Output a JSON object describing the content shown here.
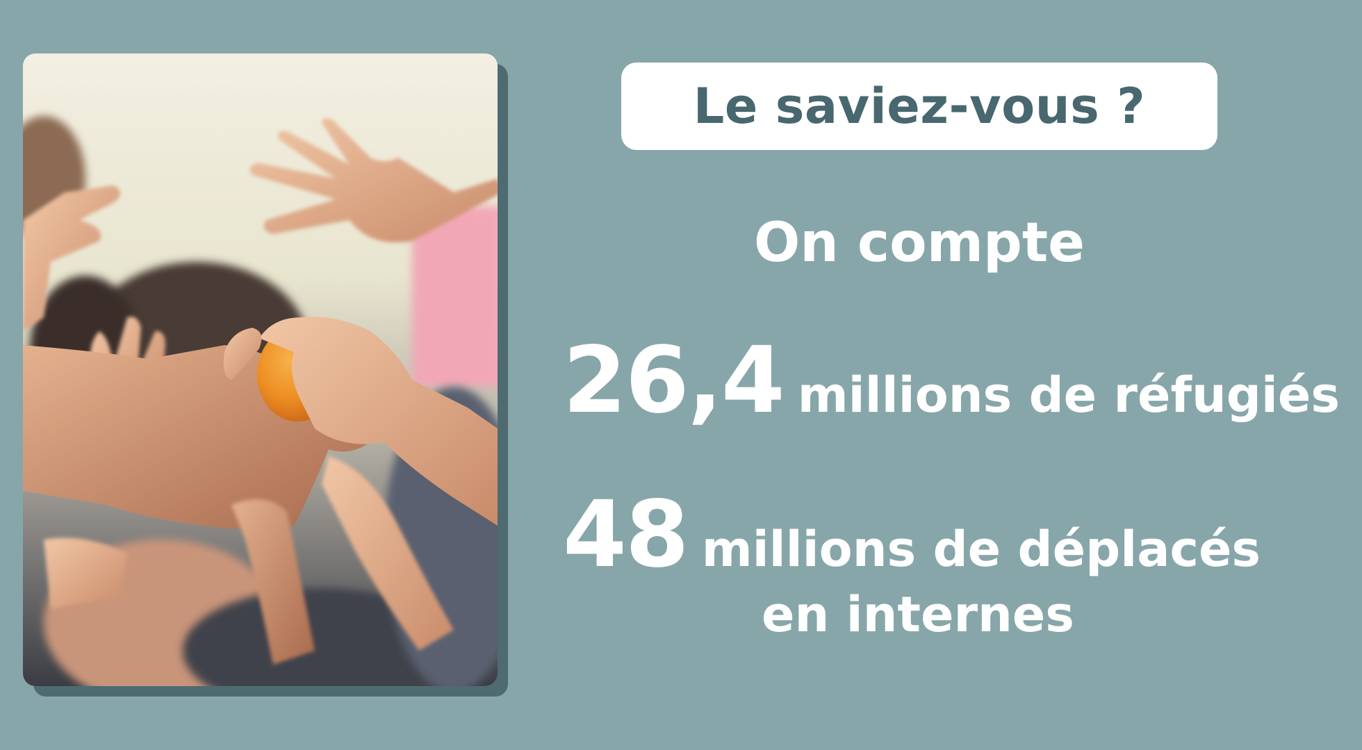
{
  "title": "Le saviez-vous ?",
  "intro": "On compte",
  "stats": [
    {
      "number": "26,4",
      "label": "millions de réfugiés"
    },
    {
      "number": "48",
      "label": "millions de déplacés",
      "label_cont": "en internes"
    }
  ],
  "colors": {
    "background": "#87a6a9",
    "title_text": "#48676e",
    "title_box": "#ffffff",
    "photo_shadow": "#4e6b72",
    "text": "#ffffff"
  },
  "image": {
    "subject": "children-hands-reaching-for-orange"
  }
}
